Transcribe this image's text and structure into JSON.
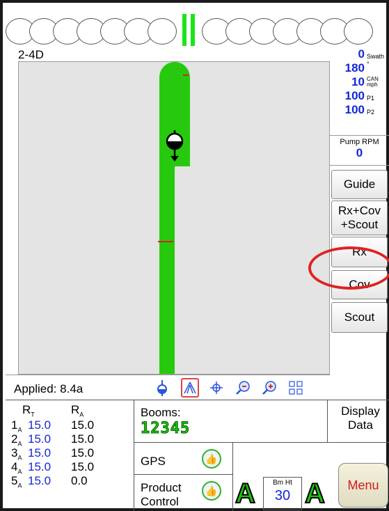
{
  "field": {
    "product_name": "2-4D"
  },
  "readouts": {
    "swath": {
      "value": "0",
      "unit": "Swath"
    },
    "heading": {
      "value": "180",
      "unit": "°"
    },
    "speed": {
      "value": "10",
      "unit_top": "CAN",
      "unit_bottom": "mph"
    },
    "p1": {
      "value": "100",
      "unit": "P1"
    },
    "p2": {
      "value": "100",
      "unit": "P2"
    },
    "pump": {
      "label": "Pump RPM",
      "value": "0"
    }
  },
  "side_buttons": [
    "Guide",
    "Rx+Cov +Scout",
    "Rx",
    "Cov",
    "Scout"
  ],
  "status": {
    "applied": "Applied: 8.4a",
    "tools": [
      "vehicle-locate-icon",
      "guidance-view-icon",
      "pan-crosshair-icon",
      "zoom-out-icon",
      "zoom-in-icon",
      "fit-extent-icon"
    ]
  },
  "rates": {
    "header_rt": "R",
    "header_rt_sub": "T",
    "header_ra": "R",
    "header_ra_sub": "A",
    "rows": [
      {
        "idx": "1",
        "sub": "A",
        "rt": "15.0",
        "ra": "15.0"
      },
      {
        "idx": "2",
        "sub": "A",
        "rt": "15.0",
        "ra": "15.0"
      },
      {
        "idx": "3",
        "sub": "A",
        "rt": "15.0",
        "ra": "15.0"
      },
      {
        "idx": "4",
        "sub": "A",
        "rt": "15.0",
        "ra": "15.0"
      },
      {
        "idx": "5",
        "sub": "A",
        "rt": "15.0",
        "ra": "0.0"
      }
    ]
  },
  "booms": {
    "label": "Booms:",
    "value": "12345"
  },
  "gps": {
    "label": "GPS"
  },
  "product_control": {
    "label_line1": "Product",
    "label_line2": "Control",
    "mode": "A"
  },
  "boom_height": {
    "label": "Bm Ht",
    "value": "30",
    "mode": "A"
  },
  "display_data": {
    "line1": "Display",
    "line2": "Data"
  },
  "menu": {
    "label": "Menu"
  },
  "colors": {
    "accent_green": "#27c90e",
    "value_blue": "#1326d8",
    "alert_red": "#d42020"
  }
}
